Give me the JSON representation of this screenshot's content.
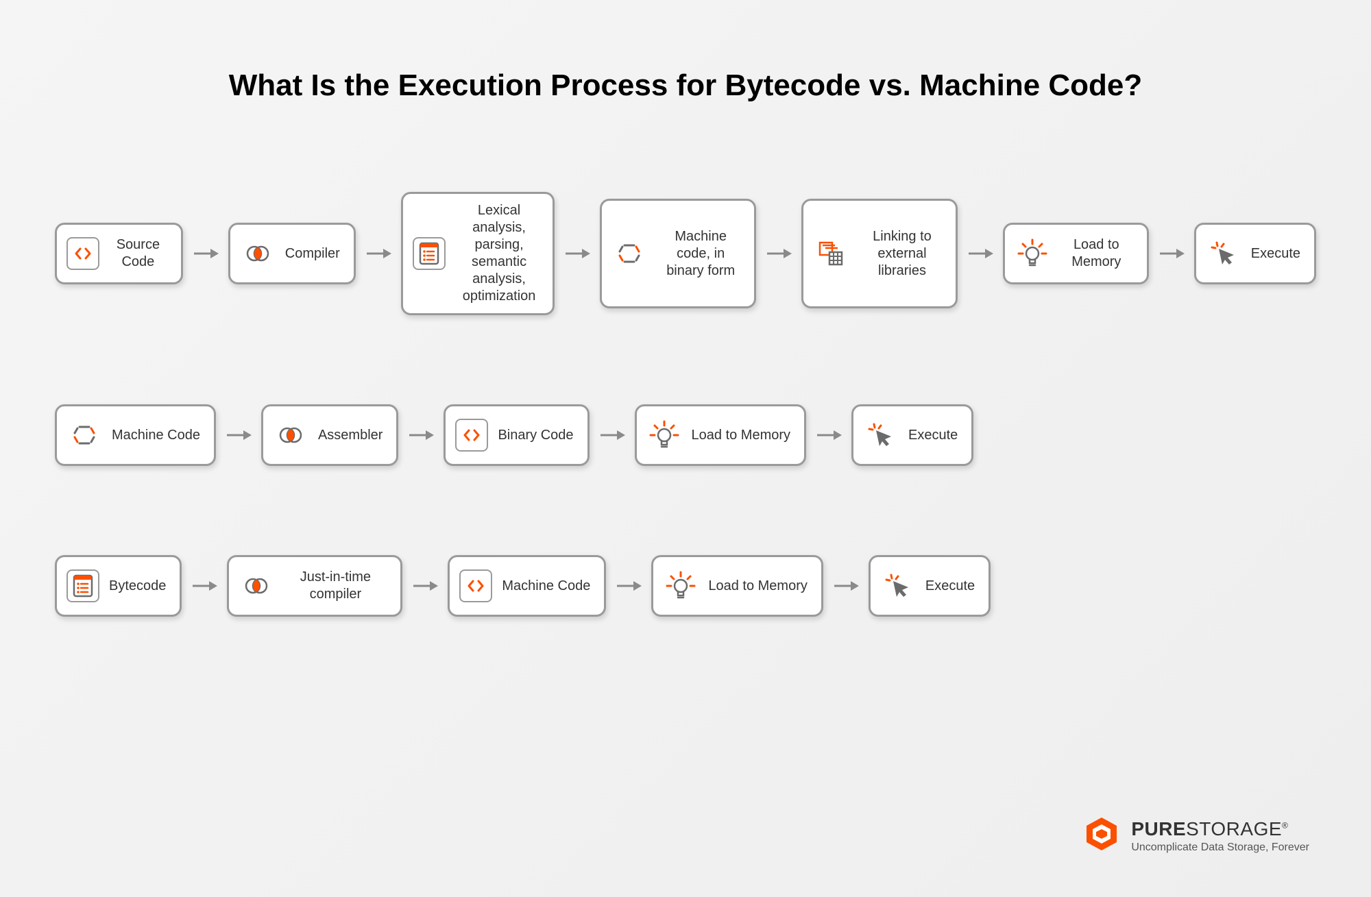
{
  "title": "What Is the Execution Process for Bytecode vs. Machine Code?",
  "rows": [
    {
      "id": "source-code-row",
      "nodes": [
        {
          "id": "source-code",
          "icon": "code-brackets",
          "label": "Source Code"
        },
        {
          "id": "compiler",
          "icon": "venn",
          "label": "Compiler"
        },
        {
          "id": "analysis",
          "icon": "list-doc",
          "label": "Lexical analysis, parsing, semantic analysis, optimization",
          "tall": true
        },
        {
          "id": "machine-binary",
          "icon": "hexagon",
          "label": "Machine code, in binary form",
          "tall": true
        },
        {
          "id": "linking",
          "icon": "library",
          "label": "Linking to external libraries",
          "tall": true
        },
        {
          "id": "load-memory-1",
          "icon": "bulb",
          "label": "Load to Memory"
        },
        {
          "id": "execute-1",
          "icon": "click",
          "label": "Execute"
        }
      ]
    },
    {
      "id": "machine-code-row",
      "nodes": [
        {
          "id": "machine-code",
          "icon": "hexagon",
          "label": "Machine Code"
        },
        {
          "id": "assembler",
          "icon": "venn",
          "label": "Assembler"
        },
        {
          "id": "binary-code",
          "icon": "code-brackets",
          "label": "Binary Code"
        },
        {
          "id": "load-memory-2",
          "icon": "bulb",
          "label": "Load to Memory"
        },
        {
          "id": "execute-2",
          "icon": "click",
          "label": "Execute"
        }
      ]
    },
    {
      "id": "bytecode-row",
      "nodes": [
        {
          "id": "bytecode",
          "icon": "list-doc",
          "label": "Bytecode"
        },
        {
          "id": "jit",
          "icon": "venn",
          "label": "Just-in-time compiler"
        },
        {
          "id": "machine-code-2",
          "icon": "code-brackets",
          "label": "Machine Code"
        },
        {
          "id": "load-memory-3",
          "icon": "bulb",
          "label": "Load to Memory"
        },
        {
          "id": "execute-3",
          "icon": "click",
          "label": "Execute"
        }
      ]
    }
  ],
  "brand": {
    "name_bold": "PURE",
    "name_light": "STORAGE",
    "registered": "®",
    "tagline": "Uncomplicate Data Storage, Forever"
  },
  "colors": {
    "accent": "#fb5000",
    "border": "#9a9a9a",
    "icon_dark": "#6b6b6b"
  }
}
